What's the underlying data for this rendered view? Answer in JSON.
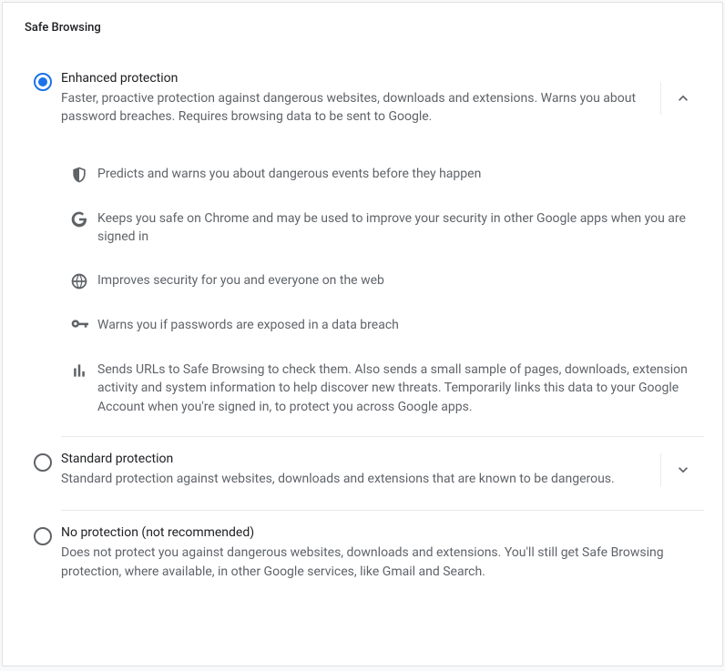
{
  "section_title": "Safe Browsing",
  "options": {
    "enhanced": {
      "title": "Enhanced protection",
      "desc": "Faster, proactive protection against dangerous websites, downloads and extensions. Warns you about password breaches. Requires browsing data to be sent to Google.",
      "selected": true,
      "expanded": true,
      "features": {
        "f0": "Predicts and warns you about dangerous events before they happen",
        "f1": "Keeps you safe on Chrome and may be used to improve your security in other Google apps when you are signed in",
        "f2": "Improves security for you and everyone on the web",
        "f3": "Warns you if passwords are exposed in a data breach",
        "f4": "Sends URLs to Safe Browsing to check them. Also sends a small sample of pages, downloads, extension activity and system information to help discover new threats. Temporarily links this data to your Google Account when you're signed in, to protect you across Google apps."
      }
    },
    "standard": {
      "title": "Standard protection",
      "desc": "Standard protection against websites, downloads and extensions that are known to be dangerous.",
      "selected": false,
      "expanded": false
    },
    "none": {
      "title": "No protection (not recommended)",
      "desc": "Does not protect you against dangerous websites, downloads and extensions. You'll still get Safe Browsing protection, where available, in other Google services, like Gmail and Search.",
      "selected": false
    }
  }
}
